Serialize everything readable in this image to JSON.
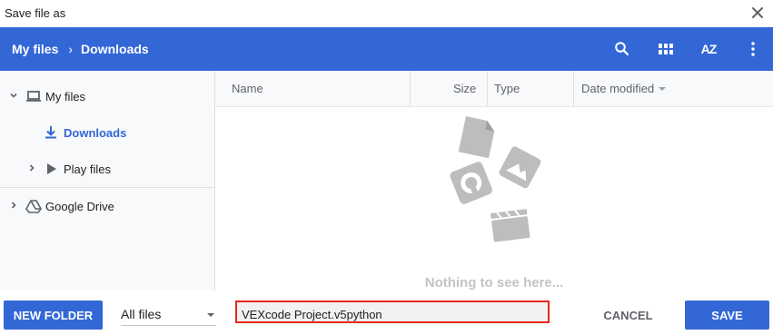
{
  "dialog": {
    "title": "Save file as"
  },
  "breadcrumb": {
    "root": "My files",
    "separator": "›",
    "current": "Downloads"
  },
  "toolbar": {
    "search_icon": "search-icon",
    "view_icon": "grid-view-icon",
    "sort_icon": "sort-az-icon",
    "sort_label": "AZ",
    "more_icon": "more-vert-icon"
  },
  "sidebar": {
    "items": [
      {
        "label": "My files",
        "icon": "laptop-icon",
        "expanded": true
      },
      {
        "label": "Downloads",
        "icon": "download-icon",
        "selected": true
      },
      {
        "label": "Play files",
        "icon": "play-icon",
        "expanded": false
      },
      {
        "label": "Google Drive",
        "icon": "drive-icon",
        "expanded": false
      }
    ]
  },
  "table": {
    "columns": [
      {
        "label": "Name"
      },
      {
        "label": "Size"
      },
      {
        "label": "Type"
      },
      {
        "label": "Date modified",
        "sorted": "desc"
      }
    ]
  },
  "empty_state": {
    "text": "Nothing to see here..."
  },
  "footer": {
    "new_folder_label": "NEW FOLDER",
    "filter_value": "All files",
    "filename_value": "VEXcode Project.v5python",
    "cancel_label": "CANCEL",
    "save_label": "SAVE"
  },
  "colors": {
    "accent": "#3367d6",
    "highlight_border": "#e8291c",
    "sidebar_bg": "#f8f9fa",
    "selected_text": "#3367d6"
  }
}
